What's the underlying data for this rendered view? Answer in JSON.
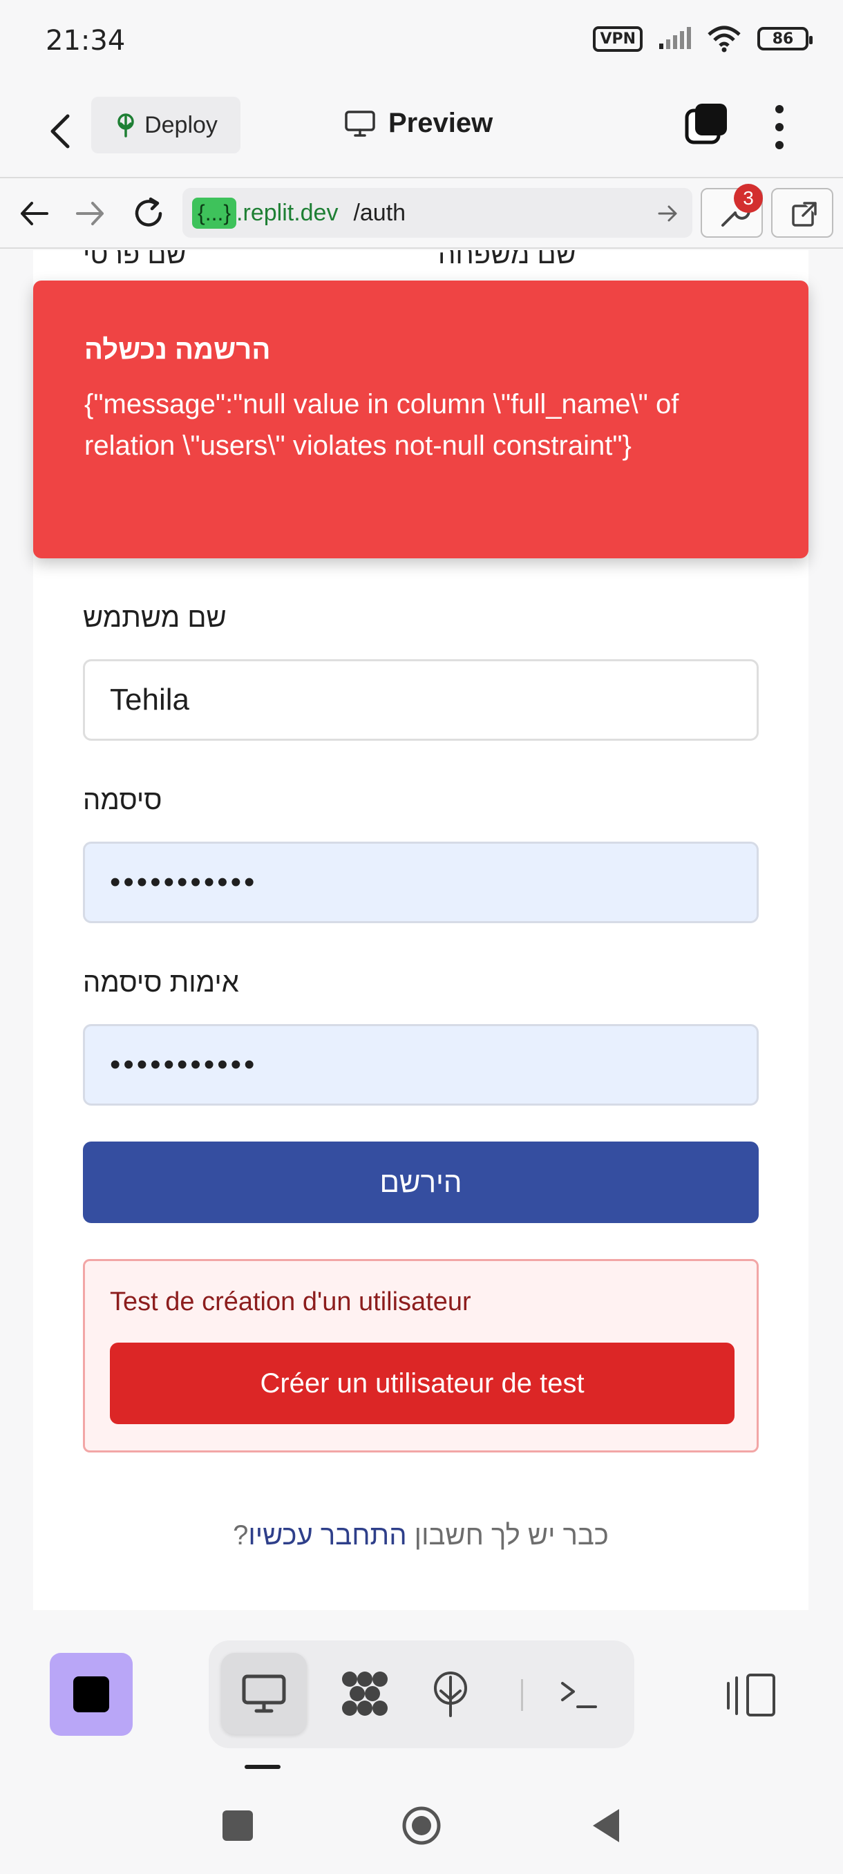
{
  "status_bar": {
    "time": "21:34",
    "vpn_label": "VPN",
    "battery_level": "86"
  },
  "app_bar": {
    "deploy_label": "Deploy",
    "title": "Preview"
  },
  "url_bar": {
    "host_tag": "{...}",
    "host": ".replit.dev",
    "path": "/auth",
    "notification_count": "3"
  },
  "form": {
    "first_name_label": "שם פרטי",
    "last_name_label": "שם משפחה",
    "username_label": "שם משתמש",
    "username_value": "Tehila",
    "password_label": "סיסמה",
    "password_value": "•••••••••••",
    "confirm_password_label": "אימות סיסמה",
    "confirm_password_value": "•••••••••••",
    "register_button": "הירשם",
    "test_box_title": "Test de création d'un utilisateur",
    "test_button": "Créer un utilisateur de test",
    "login_prompt": "?כבר יש לך חשבון",
    "login_link": "התחבר עכשיו"
  },
  "toast": {
    "title": "הרשמה נכשלה",
    "message": "{\"message\":\"null value in column \\\"full_name\\\" of relation \\\"users\\\" violates not-null constraint\"}",
    "color": "#ef4444"
  },
  "bottom_toolbar": {
    "tools": [
      "preview-icon",
      "workspace-icon",
      "deploy-icon",
      "console-icon"
    ],
    "accent": "#b9a6f7"
  }
}
